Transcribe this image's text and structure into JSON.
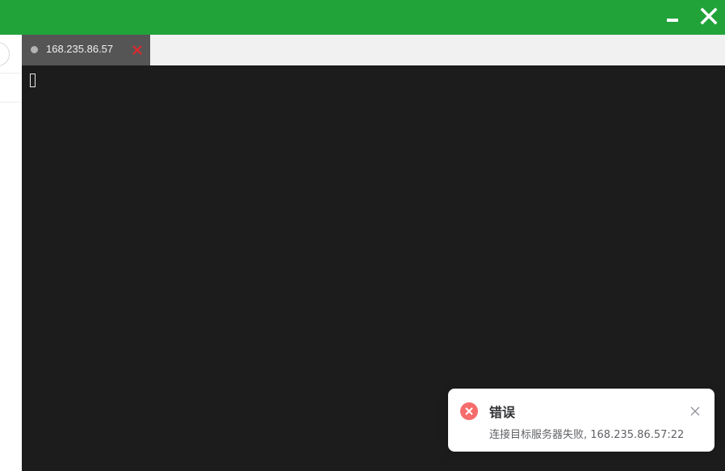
{
  "colors": {
    "titlebar": "#21a33a",
    "terminal_bg": "#1c1c1c",
    "tab_active_bg": "#555555",
    "tab_close": "#e0282e",
    "error_icon": "#f56c6c"
  },
  "window_controls": {
    "minimize_icon": "minimize-icon",
    "close_icon": "close-icon"
  },
  "tabs": [
    {
      "label": "168.235.86.57",
      "status_icon": "status-dot-icon",
      "close_icon": "close-icon",
      "active": true
    }
  ],
  "terminal": {
    "cursor": "block-cursor"
  },
  "notification": {
    "type": "error",
    "icon": "error-circle-icon",
    "title": "错误",
    "message": "连接目标服务器失败, 168.235.86.57:22",
    "close_icon": "close-icon"
  }
}
